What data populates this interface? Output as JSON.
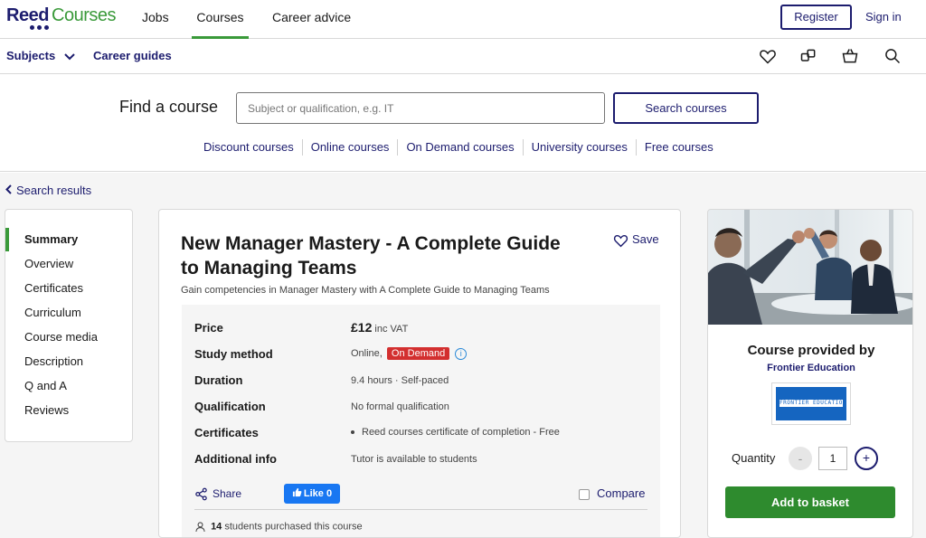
{
  "brand": {
    "name_part1": "Reed",
    "name_part2": "Courses",
    "color_primary": "#1c1c6e",
    "color_accent": "#3a9a3a"
  },
  "topnav": {
    "items": [
      {
        "label": "Jobs",
        "active": false
      },
      {
        "label": "Courses",
        "active": true
      },
      {
        "label": "Career advice",
        "active": false
      }
    ],
    "register_label": "Register",
    "signin_label": "Sign in"
  },
  "subnav": {
    "subjects_label": "Subjects",
    "career_guides_label": "Career guides",
    "icons": [
      "heart-icon",
      "compare-icon",
      "basket-icon",
      "search-icon"
    ]
  },
  "find": {
    "title": "Find a course",
    "placeholder": "Subject or qualification, e.g. IT",
    "button_label": "Search courses",
    "quick_links": [
      "Discount courses",
      "Online courses",
      "On Demand courses",
      "University courses",
      "Free courses"
    ]
  },
  "back_link_label": "Search results",
  "sidebar": {
    "items": [
      {
        "label": "Summary",
        "active": true
      },
      {
        "label": "Overview",
        "active": false
      },
      {
        "label": "Certificates",
        "active": false
      },
      {
        "label": "Curriculum",
        "active": false
      },
      {
        "label": "Course media",
        "active": false
      },
      {
        "label": "Description",
        "active": false
      },
      {
        "label": "Q and A",
        "active": false
      },
      {
        "label": "Reviews",
        "active": false
      }
    ]
  },
  "course": {
    "title": "New Manager Mastery - A Complete Guide to Managing Teams",
    "subtitle": "Gain competencies in Manager Mastery with A Complete Guide to Managing Teams",
    "save_label": "Save",
    "details": {
      "price_label": "Price",
      "price_value": "£12",
      "price_suffix": "inc VAT",
      "study_method_label": "Study method",
      "study_method_value": "Online,",
      "study_method_badge": "On Demand",
      "duration_label": "Duration",
      "duration_value": "9.4 hours · Self-paced",
      "qualification_label": "Qualification",
      "qualification_value": "No formal qualification",
      "certificates_label": "Certificates",
      "certificates_value": "Reed courses certificate of completion - Free",
      "additional_label": "Additional info",
      "additional_value": "Tutor is available to students"
    },
    "share_label": "Share",
    "like_label": "Like 0",
    "compare_label": "Compare",
    "students_count": "14",
    "students_text": "students purchased this course"
  },
  "provider": {
    "heading": "Course provided by",
    "name": "Frontier Education",
    "logo_text": "FRONTIER EDUCATION",
    "quantity_label": "Quantity",
    "quantity_value": "1",
    "minus_symbol": "-",
    "plus_symbol": "+",
    "add_button_label": "Add to basket"
  }
}
